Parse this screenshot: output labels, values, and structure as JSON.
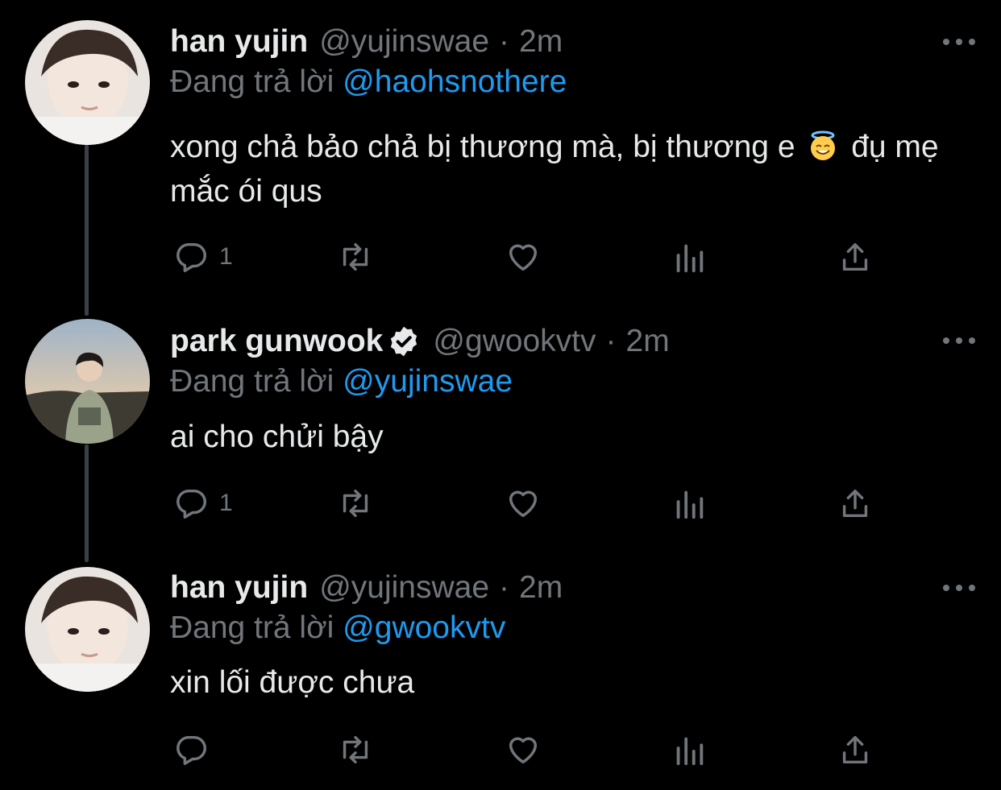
{
  "colors": {
    "background": "#000000",
    "text_primary": "#e7e9ea",
    "text_secondary": "#71767b",
    "mention": "#1d9bf0",
    "thread_line": "#3b4045"
  },
  "reply_prefix": "Đang trả lời",
  "tweets": [
    {
      "name": "han yujin",
      "verified": false,
      "handle": "@yujinswae",
      "separator": "·",
      "time": "2m",
      "reply_to": "@haohsnothere",
      "text_before_emoji": "xong chả bảo chả bị thương mà, bị thương e",
      "emoji": "smiling-face-with-halo",
      "text_after_emoji": "đụ mẹ mắc ói qus",
      "reply_count": "1"
    },
    {
      "name": "park gunwook",
      "verified": true,
      "handle": "@gwookvtv",
      "separator": "·",
      "time": "2m",
      "reply_to": "@yujinswae",
      "text": "ai cho chửi bậy",
      "reply_count": "1"
    },
    {
      "name": "han yujin",
      "verified": false,
      "handle": "@yujinswae",
      "separator": "·",
      "time": "2m",
      "reply_to": "@gwookvtv",
      "text": "xin lối được chưa",
      "reply_count": ""
    }
  ],
  "action_icons": [
    "reply-icon",
    "retweet-icon",
    "like-icon",
    "analytics-icon",
    "share-icon"
  ]
}
